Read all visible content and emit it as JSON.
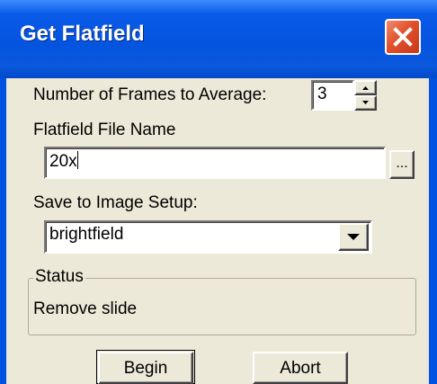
{
  "window": {
    "title": "Get Flatfield"
  },
  "frames": {
    "label": "Number of Frames to Average:",
    "value": "3"
  },
  "file": {
    "label": "Flatfield File Name",
    "value": "20x",
    "browse_label": "..."
  },
  "setup": {
    "label": "Save to Image Setup:",
    "selected": "brightfield"
  },
  "status": {
    "group_label": "Status",
    "text": "Remove slide"
  },
  "buttons": {
    "begin": "Begin",
    "abort": "Abort"
  },
  "icons": {
    "close": "close-icon",
    "spin_up": "arrow-up-icon",
    "spin_down": "arrow-down-icon",
    "dropdown": "chevron-down-icon"
  },
  "colors": {
    "title_bar": "#0454e0",
    "close_button": "#e0512a",
    "dialog_face": "#ece9d8"
  }
}
